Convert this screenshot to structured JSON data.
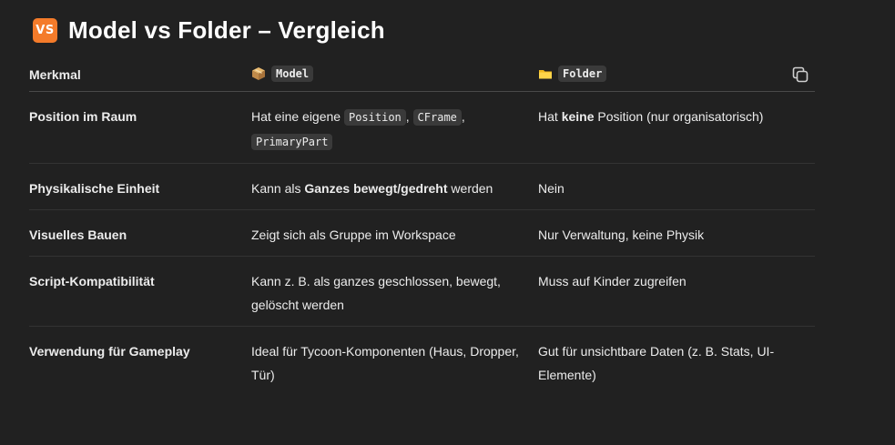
{
  "heading": {
    "badge": "VS",
    "title": "Model vs Folder – Vergleich"
  },
  "table": {
    "header": {
      "feature": "Merkmal",
      "model": "Model",
      "folder": "Folder"
    },
    "rows": [
      {
        "feature": "Position im Raum",
        "model": [
          {
            "t": "text",
            "v": "Hat eine eigene "
          },
          {
            "t": "code",
            "v": "Position"
          },
          {
            "t": "text",
            "v": ", "
          },
          {
            "t": "code",
            "v": "CFrame"
          },
          {
            "t": "text",
            "v": ", "
          },
          {
            "t": "code",
            "v": "PrimaryPart"
          }
        ],
        "folder": [
          {
            "t": "text",
            "v": "Hat "
          },
          {
            "t": "bold",
            "v": "keine"
          },
          {
            "t": "text",
            "v": " Position (nur organisatorisch)"
          }
        ]
      },
      {
        "feature": "Physikalische Einheit",
        "model": [
          {
            "t": "text",
            "v": "Kann als "
          },
          {
            "t": "bold",
            "v": "Ganzes bewegt/gedreht"
          },
          {
            "t": "text",
            "v": " werden"
          }
        ],
        "folder": [
          {
            "t": "text",
            "v": "Nein"
          }
        ]
      },
      {
        "feature": "Visuelles Bauen",
        "model": [
          {
            "t": "text",
            "v": "Zeigt sich als Gruppe im Workspace"
          }
        ],
        "folder": [
          {
            "t": "text",
            "v": "Nur Verwaltung, keine Physik"
          }
        ]
      },
      {
        "feature": "Script-Kompatibilität",
        "model": [
          {
            "t": "text",
            "v": "Kann z. B. als ganzes geschlossen, bewegt, gelöscht werden"
          }
        ],
        "folder": [
          {
            "t": "text",
            "v": "Muss auf Kinder zugreifen"
          }
        ]
      },
      {
        "feature": "Verwendung für Gameplay",
        "model": [
          {
            "t": "text",
            "v": "Ideal für Tycoon-Komponenten (Haus, Dropper, Tür)"
          }
        ],
        "folder": [
          {
            "t": "text",
            "v": "Gut für unsichtbare Daten (z. B. Stats, UI-Elemente)"
          }
        ]
      }
    ]
  },
  "icons": {
    "model_icon": "package-icon",
    "folder_icon": "folder-icon",
    "copy_icon": "copy-icon"
  },
  "colors": {
    "background": "#212121",
    "badge": "#f47b2a",
    "code_bg": "#3a3a3a"
  }
}
